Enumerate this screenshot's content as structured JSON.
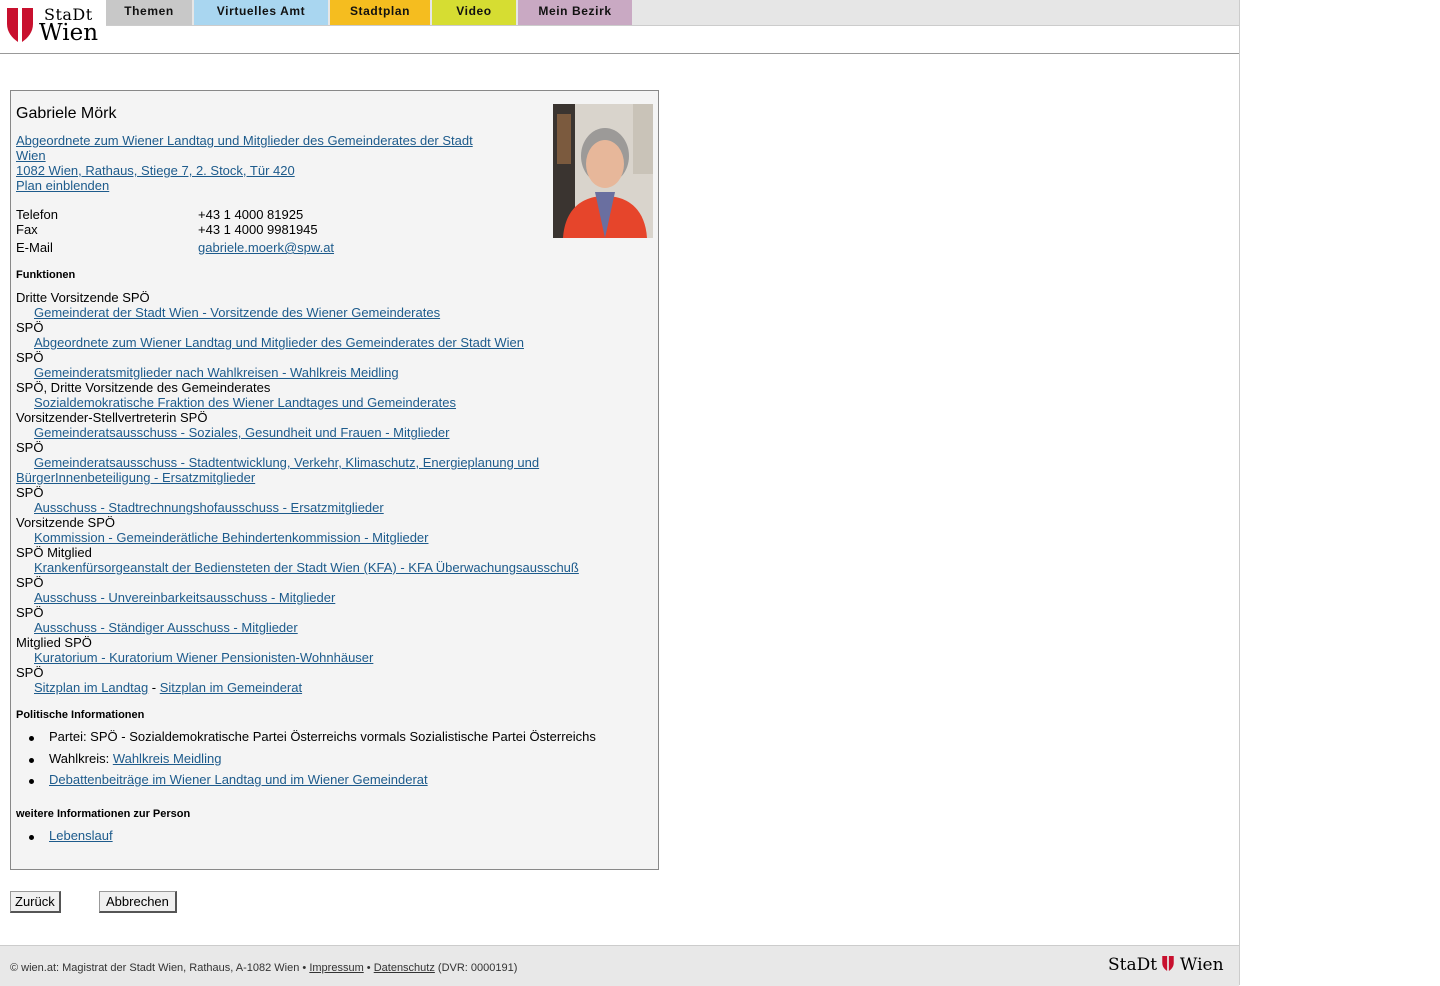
{
  "logo": {
    "top_text": "StaDt",
    "bottom_text": "Wien"
  },
  "nav": {
    "tabs": [
      {
        "label": "Themen",
        "color": "#c8c8c8"
      },
      {
        "label": "Virtuelles Amt",
        "color": "#a9d6f0"
      },
      {
        "label": "Stadtplan",
        "color": "#f5bd1f"
      },
      {
        "label": "Video",
        "color": "#d6dd32"
      },
      {
        "label": "Mein Bezirk",
        "color": "#c9a9c3"
      }
    ]
  },
  "person": {
    "name": "Gabriele Mörk",
    "role_link_line1": "Abgeordnete zum Wiener Landtag und Mitglieder des Gemeinderates der Stadt",
    "role_link_line2": "Wien ",
    "address": "1082 Wien, Rathaus, Stiege 7, 2. Stock, Tür 420",
    "plan_link": "Plan einblenden",
    "phone_label": "Telefon",
    "phone": "+43 1 4000 81925",
    "fax_label": "Fax",
    "fax": "+43 1 4000 9981945",
    "email_label": "E-Mail",
    "email": "gabriele.moerk@spw.at"
  },
  "functions": {
    "heading": "Funktionen",
    "rows": [
      {
        "text": "Dritte Vorsitzende SPÖ"
      },
      {
        "link": "Gemeinderat der Stadt Wien - Vorsitzende des Wiener Gemeinderates"
      },
      {
        "text": "SPÖ"
      },
      {
        "link": "Abgeordnete zum Wiener Landtag und Mitglieder des Gemeinderates der Stadt Wien"
      },
      {
        "text": "SPÖ"
      },
      {
        "link": "Gemeinderatsmitglieder nach Wahlkreisen - Wahlkreis Meidling"
      },
      {
        "text": "SPÖ, Dritte Vorsitzende des Gemeinderates"
      },
      {
        "link": "Sozialdemokratische Fraktion des Wiener Landtages und Gemeinderates"
      },
      {
        "text": "Vorsitzender-Stellvertreterin SPÖ"
      },
      {
        "link": "Gemeinderatsausschuss - Soziales, Gesundheit und Frauen - Mitglieder"
      },
      {
        "text": "SPÖ"
      },
      {
        "link": "Gemeinderatsausschuss - Stadtentwicklung, Verkehr, Klimaschutz, Energieplanung und"
      },
      {
        "link_wrap": "BürgerInnenbeteiligung - Ersatzmitglieder"
      },
      {
        "text": "SPÖ"
      },
      {
        "link": "Ausschuss - Stadtrechnungshofausschuss - Ersatzmitglieder"
      },
      {
        "text": "Vorsitzende SPÖ"
      },
      {
        "link": "Kommission - Gemeinderätliche Behindertenkommission - Mitglieder"
      },
      {
        "text": "SPÖ Mitglied"
      },
      {
        "link": "Krankenfürsorgeanstalt der Bediensteten der Stadt Wien (KFA) - KFA Überwachungsausschuß"
      },
      {
        "text": "SPÖ"
      },
      {
        "link": "Ausschuss - Unvereinbarkeitsausschuss - Mitglieder"
      },
      {
        "text": "SPÖ"
      },
      {
        "link": "Ausschuss - Ständiger Ausschuss - Mitglieder"
      },
      {
        "text": "Mitglied SPÖ"
      },
      {
        "link": "Kuratorium - Kuratorium Wiener Pensionisten-Wohnhäuser"
      },
      {
        "text": "SPÖ"
      }
    ],
    "sitzplan_landtag": "Sitzplan im Landtag",
    "sitzplan_sep": " - ",
    "sitzplan_gemeinderat": "Sitzplan im Gemeinderat"
  },
  "political": {
    "heading": "Politische Informationen",
    "party": "Partei: SPÖ - Sozialdemokratische Partei Österreichs vormals Sozialistische Partei Österreichs",
    "wahlkreis_label": "Wahlkreis: ",
    "wahlkreis_link": "Wahlkreis Meidling",
    "debate_link": "Debattenbeiträge im Wiener Landtag und im Wiener Gemeinderat"
  },
  "more": {
    "heading": "weitere Informationen zur Person",
    "cv_link": "Lebenslauf"
  },
  "buttons": {
    "back": "Zurück",
    "cancel": "Abbrechen"
  },
  "footer": {
    "prefix": "© wien.at: Magistrat der Stadt Wien, Rathaus, A-1082 Wien • ",
    "impressum": "Impressum",
    "sep": " • ",
    "datenschutz": "Datenschutz",
    "suffix": " (DVR: 0000191)",
    "logo_left": "StaDt",
    "logo_right": "Wien"
  }
}
